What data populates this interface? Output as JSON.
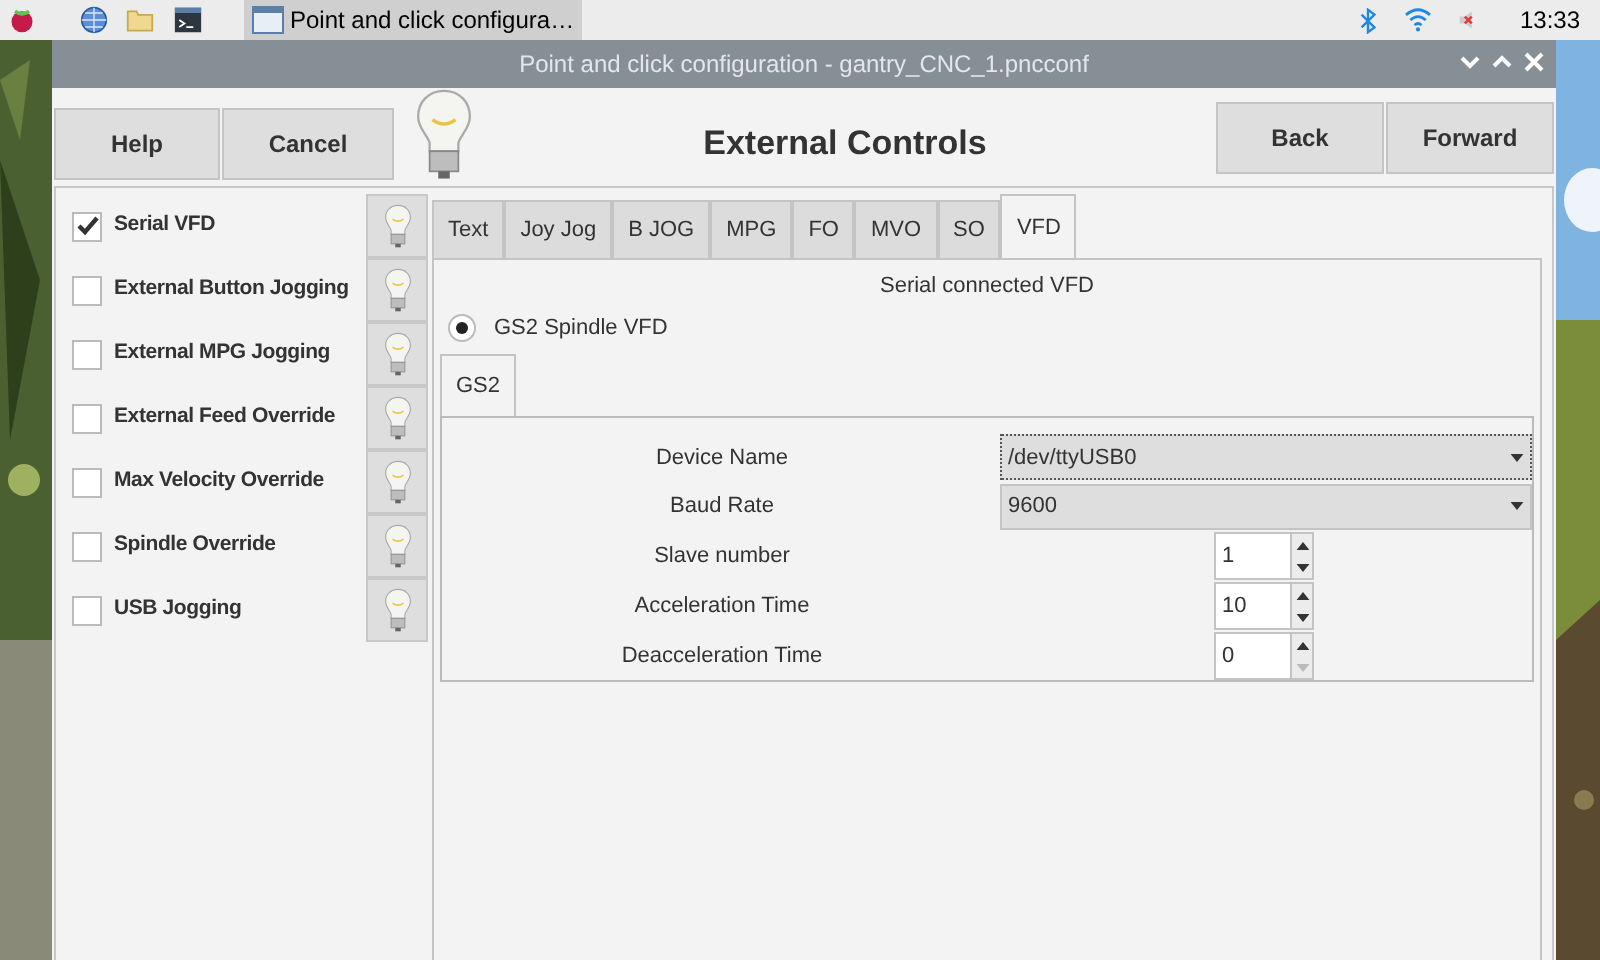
{
  "taskbar": {
    "task": {
      "title": "Point and click configura…",
      "selected": true
    },
    "clock": "13:33"
  },
  "window": {
    "title": "Point and click configuration - gantry_CNC_1.pncconf"
  },
  "header": {
    "left_buttons": [
      "Help",
      "Cancel"
    ],
    "title": "External Controls",
    "right_buttons": [
      "Back",
      "Forward"
    ]
  },
  "options": [
    {
      "label": "Serial VFD",
      "checked": true
    },
    {
      "label": "External Button Jogging",
      "checked": false
    },
    {
      "label": "External MPG Jogging",
      "checked": false
    },
    {
      "label": "External Feed Override",
      "checked": false
    },
    {
      "label": "Max Velocity Override",
      "checked": false
    },
    {
      "label": "Spindle Override",
      "checked": false
    },
    {
      "label": "USB Jogging",
      "checked": false
    }
  ],
  "tabs": [
    {
      "label": "Text",
      "selected": false
    },
    {
      "label": "Joy Jog",
      "selected": false
    },
    {
      "label": "B JOG",
      "selected": false
    },
    {
      "label": "MPG",
      "selected": false
    },
    {
      "label": "FO",
      "selected": false
    },
    {
      "label": "MVO",
      "selected": false
    },
    {
      "label": "SO",
      "selected": false
    },
    {
      "label": "VFD",
      "selected": true
    }
  ],
  "vfd": {
    "heading": "Serial connected VFD",
    "radios": [
      {
        "label": "GS2 Spindle VFD",
        "selected": true
      }
    ],
    "subtabs": [
      {
        "label": "GS2",
        "selected": true
      }
    ],
    "fields": [
      {
        "kind": "combo",
        "label": "Device  Name",
        "value": "/dev/ttyUSB0",
        "focused": true
      },
      {
        "kind": "combo",
        "label": "Baud Rate",
        "value": "9600",
        "focused": false
      },
      {
        "kind": "spin",
        "label": "Slave number",
        "value": "1",
        "decrement_disabled": false
      },
      {
        "kind": "spin",
        "label": "Acceleration Time",
        "value": "10",
        "decrement_disabled": false
      },
      {
        "kind": "spin",
        "label": "Deacceleration Time",
        "value": "0",
        "decrement_disabled": true
      }
    ]
  }
}
